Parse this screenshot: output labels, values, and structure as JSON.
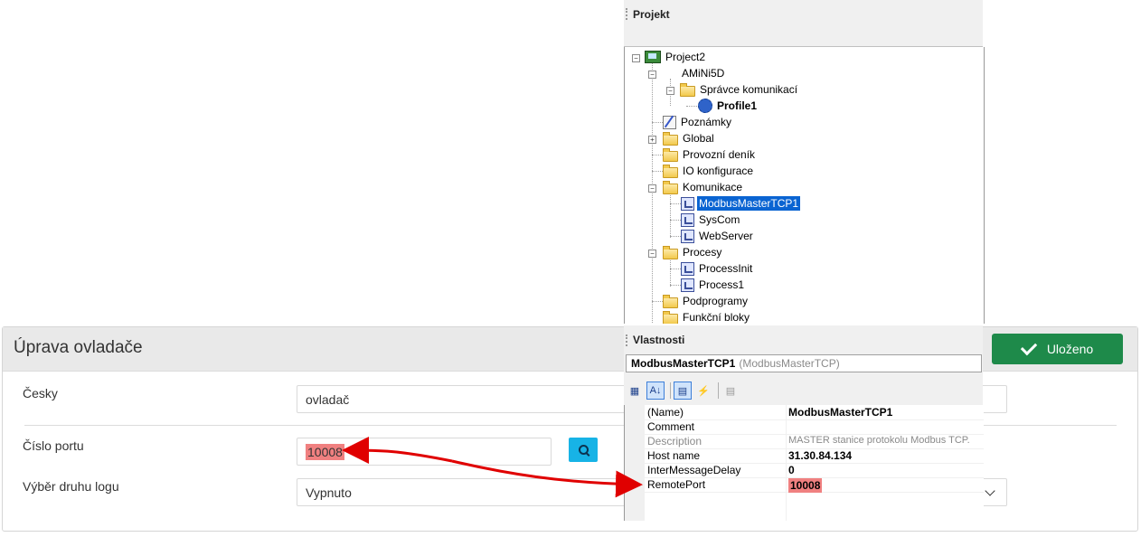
{
  "panel": {
    "title": "Úprava ovladače",
    "save_label": "Uloženo",
    "fields": {
      "czech_label": "Česky",
      "czech_value": "ovladač",
      "port_label": "Číslo portu",
      "port_value": "10008",
      "log_label": "Výběr druhu logu",
      "log_value": "Vypnuto"
    }
  },
  "project": {
    "title": "Projekt",
    "tree": {
      "project2": "Project2",
      "amini5d": "AMiNi5D",
      "comm_manager": "Správce komunikací",
      "profile1": "Profile1",
      "notes": "Poznámky",
      "global": "Global",
      "operation_log": "Provozní deník",
      "io_config": "IO konfigurace",
      "communication": "Komunikace",
      "modbus_master": "ModbusMasterTCP1",
      "syscom": "SysCom",
      "webserver": "WebServer",
      "processes": "Procesy",
      "process_init": "ProcessInit",
      "process1": "Process1",
      "subprograms": "Podprogramy",
      "function_blocks": "Funkční bloky"
    }
  },
  "properties": {
    "title": "Vlastnosti",
    "object_name": "ModbusMasterTCP1",
    "object_type": "(ModbusMasterTCP)",
    "rows": [
      {
        "name": "(Name)",
        "value": "ModbusMasterTCP1"
      },
      {
        "name": "Comment",
        "value": ""
      },
      {
        "name": "Description",
        "value": "MASTER stanice protokolu Modbus TCP."
      },
      {
        "name": "Host name",
        "value": "31.30.84.134"
      },
      {
        "name": "InterMessageDelay",
        "value": "0"
      },
      {
        "name": "RemotePort",
        "value": "10008"
      }
    ]
  },
  "colors": {
    "save_button": "#1e8a4a",
    "search_button": "#17b3e6",
    "highlight": "#f08080",
    "selection": "#0a64d2",
    "arrow": "#e00000"
  }
}
